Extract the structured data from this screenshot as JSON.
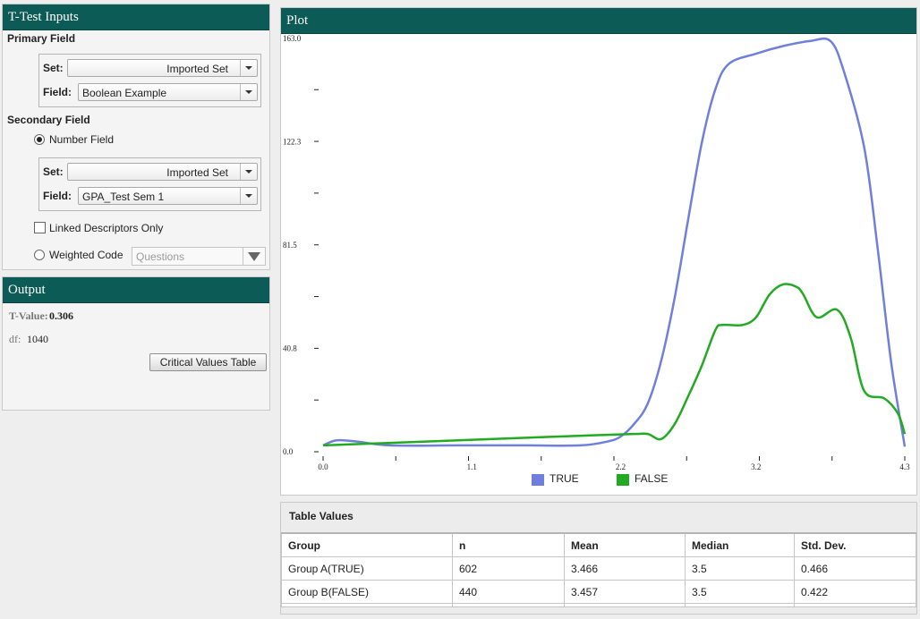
{
  "inputs": {
    "title": "T-Test Inputs",
    "primary_label": "Primary Field",
    "primary_set_label": "Set:",
    "primary_set_value": "Imported Set",
    "primary_field_label": "Field:",
    "primary_field_value": "Boolean Example",
    "secondary_label": "Secondary Field",
    "number_field_label": "Number Field",
    "secondary_set_label": "Set:",
    "secondary_set_value": "Imported Set",
    "secondary_field_label": "Field:",
    "secondary_field_value": "GPA_Test Sem 1",
    "linked_label": "Linked Descriptors Only",
    "weighted_label": "Weighted Code",
    "weighted_placeholder": "Questions"
  },
  "output": {
    "title": "Output",
    "tvalue_label": "T-Value:",
    "tvalue": "0.306",
    "df_label": "df:",
    "df": "1040",
    "critical_button": "Critical Values Table"
  },
  "plot": {
    "title": "Plot"
  },
  "chart_data": {
    "type": "line",
    "title": "",
    "xlabel": "",
    "ylabel": "",
    "xlim": [
      0.0,
      4.3
    ],
    "ylim": [
      0.0,
      163.0
    ],
    "x_ticks": [
      "0.0",
      "1.1",
      "2.2",
      "3.2",
      "4.3"
    ],
    "y_ticks": [
      "0.0",
      "40.8",
      "81.5",
      "122.3",
      "163.0"
    ],
    "legend_position": "bottom-center",
    "series": [
      {
        "name": "TRUE",
        "color": "#6f7fdc",
        "points": [
          [
            0.0,
            2.5
          ],
          [
            0.1,
            4.5
          ],
          [
            0.25,
            4
          ],
          [
            0.5,
            2.5
          ],
          [
            1.0,
            2.5
          ],
          [
            1.5,
            2.5
          ],
          [
            1.9,
            2.5
          ],
          [
            2.1,
            4
          ],
          [
            2.2,
            6
          ],
          [
            2.3,
            11
          ],
          [
            2.4,
            19
          ],
          [
            2.5,
            36
          ],
          [
            2.6,
            61
          ],
          [
            2.7,
            92
          ],
          [
            2.8,
            122
          ],
          [
            2.9,
            143
          ],
          [
            3.0,
            153
          ],
          [
            3.2,
            157
          ],
          [
            3.4,
            160
          ],
          [
            3.6,
            162
          ],
          [
            3.75,
            162
          ],
          [
            3.85,
            150
          ],
          [
            4.0,
            120
          ],
          [
            4.1,
            80
          ],
          [
            4.2,
            35
          ],
          [
            4.3,
            2
          ]
        ]
      },
      {
        "name": "FALSE",
        "color": "#22aa22",
        "points": [
          [
            0.0,
            2.5
          ],
          [
            0.5,
            3.5
          ],
          [
            1.0,
            4.5
          ],
          [
            1.5,
            5.5
          ],
          [
            2.0,
            6.5
          ],
          [
            2.3,
            7
          ],
          [
            2.4,
            7
          ],
          [
            2.5,
            5
          ],
          [
            2.6,
            11
          ],
          [
            2.7,
            22
          ],
          [
            2.8,
            34
          ],
          [
            2.9,
            48
          ],
          [
            2.95,
            50
          ],
          [
            3.1,
            50
          ],
          [
            3.2,
            53
          ],
          [
            3.3,
            62
          ],
          [
            3.4,
            66
          ],
          [
            3.5,
            65
          ],
          [
            3.55,
            62
          ],
          [
            3.65,
            53
          ],
          [
            3.8,
            56
          ],
          [
            3.9,
            45
          ],
          [
            4.0,
            24
          ],
          [
            4.15,
            21
          ],
          [
            4.25,
            15
          ],
          [
            4.3,
            7
          ]
        ]
      }
    ]
  },
  "table": {
    "title": "Table Values",
    "headers": [
      "Group",
      "n",
      "Mean",
      "Median",
      "Std. Dev."
    ],
    "rows": [
      [
        "Group A(TRUE)",
        "602",
        "3.466",
        "3.5",
        "0.466"
      ],
      [
        "Group B(FALSE)",
        "440",
        "3.457",
        "3.5",
        "0.422"
      ]
    ]
  },
  "colors": {
    "header_bg": "#0d5b57",
    "true_series": "#6f7fdc",
    "false_series": "#22aa22"
  }
}
